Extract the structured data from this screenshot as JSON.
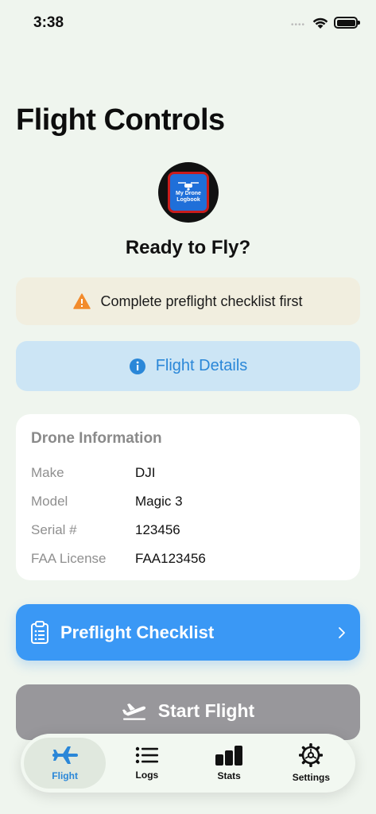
{
  "status_bar": {
    "time": "3:38",
    "signal": "••••"
  },
  "page": {
    "title": "Flight Controls",
    "subtitle": "Ready to Fly?"
  },
  "logo": {
    "line1": "My Drone",
    "line2": "Logbook"
  },
  "warning": {
    "text": "Complete preflight checklist first",
    "icon": "warning-triangle-icon",
    "color": "#f28b2c"
  },
  "details_button": {
    "label": "Flight Details",
    "icon": "info-icon"
  },
  "drone_info": {
    "title": "Drone Information",
    "rows": [
      {
        "label": "Make",
        "value": "DJI"
      },
      {
        "label": "Model",
        "value": "Magic 3"
      },
      {
        "label": "Serial #",
        "value": "123456"
      },
      {
        "label": "FAA License",
        "value": "FAA123456"
      }
    ]
  },
  "checklist_button": {
    "label": "Preflight Checklist",
    "icon": "clipboard-icon"
  },
  "start_button": {
    "label": "Start Flight",
    "icon": "plane-takeoff-icon"
  },
  "tabs": [
    {
      "label": "Flight",
      "icon": "airplane-icon",
      "active": true
    },
    {
      "label": "Logs",
      "icon": "list-icon"
    },
    {
      "label": "Stats",
      "icon": "bar-chart-icon"
    },
    {
      "label": "Settings",
      "icon": "gear-icon"
    }
  ],
  "colors": {
    "accent": "#3a98f5",
    "tab_active": "#2a87d8",
    "background": "#eff5ee"
  }
}
